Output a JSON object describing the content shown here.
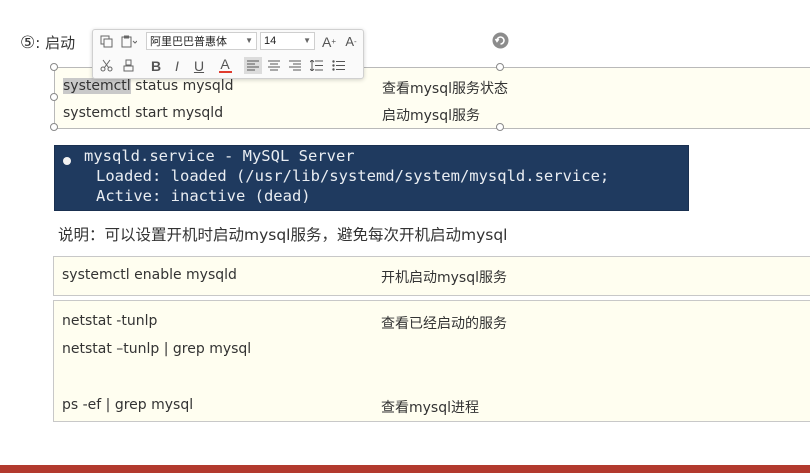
{
  "heading": {
    "num": "⑤",
    "text": ": 启动"
  },
  "toolbar": {
    "font_family": "阿里巴巴普惠体",
    "font_size": "14",
    "grow_label": "A",
    "shrink_label": "A",
    "bold_label": "B",
    "italic_label": "I",
    "underline_label": "U",
    "font_color_label": "A",
    "font_color_hex": "#e03b2e"
  },
  "table1": {
    "rows": [
      {
        "cmd_highlighted": "systemctl",
        "cmd_rest": " status mysqld",
        "desc": "查看mysql服务状态"
      },
      {
        "cmd": "systemctl start mysqld",
        "desc": "启动mysql服务"
      }
    ]
  },
  "terminal": {
    "line1": "mysqld.service - MySQL Server",
    "line2": "Loaded: loaded (/usr/lib/systemd/system/mysqld.service;",
    "line3": "Active: inactive (dead)"
  },
  "note": "说明：可以设置开机时启动mysql服务，避免每次开机启动mysql",
  "table2": {
    "rows": [
      {
        "cmd": "systemctl enable mysqld",
        "desc": "开机启动mysql服务"
      }
    ]
  },
  "table3": {
    "rows": [
      {
        "cmd": "netstat -tunlp",
        "desc": "查看已经启动的服务"
      },
      {
        "cmd": "netstat –tunlp | grep mysql",
        "desc": ""
      },
      {
        "cmd": "ps -ef | grep mysql",
        "desc": "查看mysql进程"
      }
    ]
  },
  "colors": {
    "terminal_bg": "#1f3a5f",
    "table_bg": "#fffef0",
    "bottom_bar": "#b23a2e"
  }
}
